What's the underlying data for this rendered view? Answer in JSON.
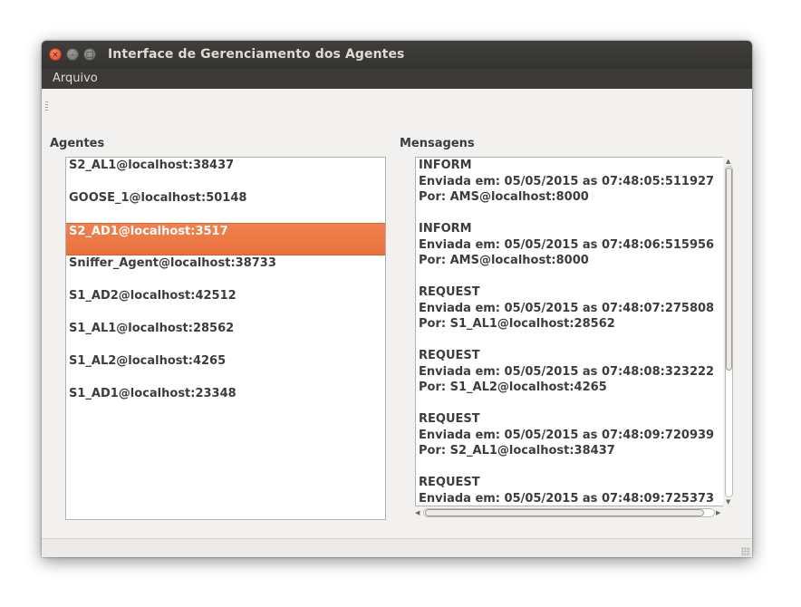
{
  "window": {
    "title": "Interface de Gerenciamento dos Agentes",
    "controls": {
      "close": "×",
      "minimize": "–",
      "maximize": "□"
    }
  },
  "menubar": {
    "items": [
      {
        "label": "Arquivo"
      }
    ]
  },
  "agents_panel": {
    "label": "Agentes",
    "selected_index": 2,
    "selected_color": "#ef7a45",
    "items": [
      {
        "label": "S2_AL1@localhost:38437"
      },
      {
        "label": "GOOSE_1@localhost:50148"
      },
      {
        "label": "S2_AD1@localhost:3517"
      },
      {
        "label": "Sniffer_Agent@localhost:38733"
      },
      {
        "label": "S1_AD2@localhost:42512"
      },
      {
        "label": "S1_AL1@localhost:28562"
      },
      {
        "label": "S1_AL2@localhost:4265"
      },
      {
        "label": "S1_AD1@localhost:23348"
      }
    ]
  },
  "messages_panel": {
    "label": "Mensagens",
    "lines": [
      "INFORM",
      "Enviada em: 05/05/2015 as 07:48:05:511927",
      "Por: AMS@localhost:8000",
      "",
      "INFORM",
      "Enviada em: 05/05/2015 as 07:48:06:515956",
      "Por: AMS@localhost:8000",
      "",
      "REQUEST",
      "Enviada em: 05/05/2015 as 07:48:07:275808",
      "Por: S1_AL1@localhost:28562",
      "",
      "REQUEST",
      "Enviada em: 05/05/2015 as 07:48:08:323222",
      "Por: S1_AL2@localhost:4265",
      "",
      "REQUEST",
      "Enviada em: 05/05/2015 as 07:48:09:720939",
      "Por: S2_AL1@localhost:38437",
      "",
      "REQUEST",
      "Enviada em: 05/05/2015 as 07:48:09:725373"
    ]
  },
  "icons": {
    "scroll_up": "▲",
    "scroll_down": "▼",
    "scroll_left": "◀",
    "scroll_right": "▶"
  }
}
